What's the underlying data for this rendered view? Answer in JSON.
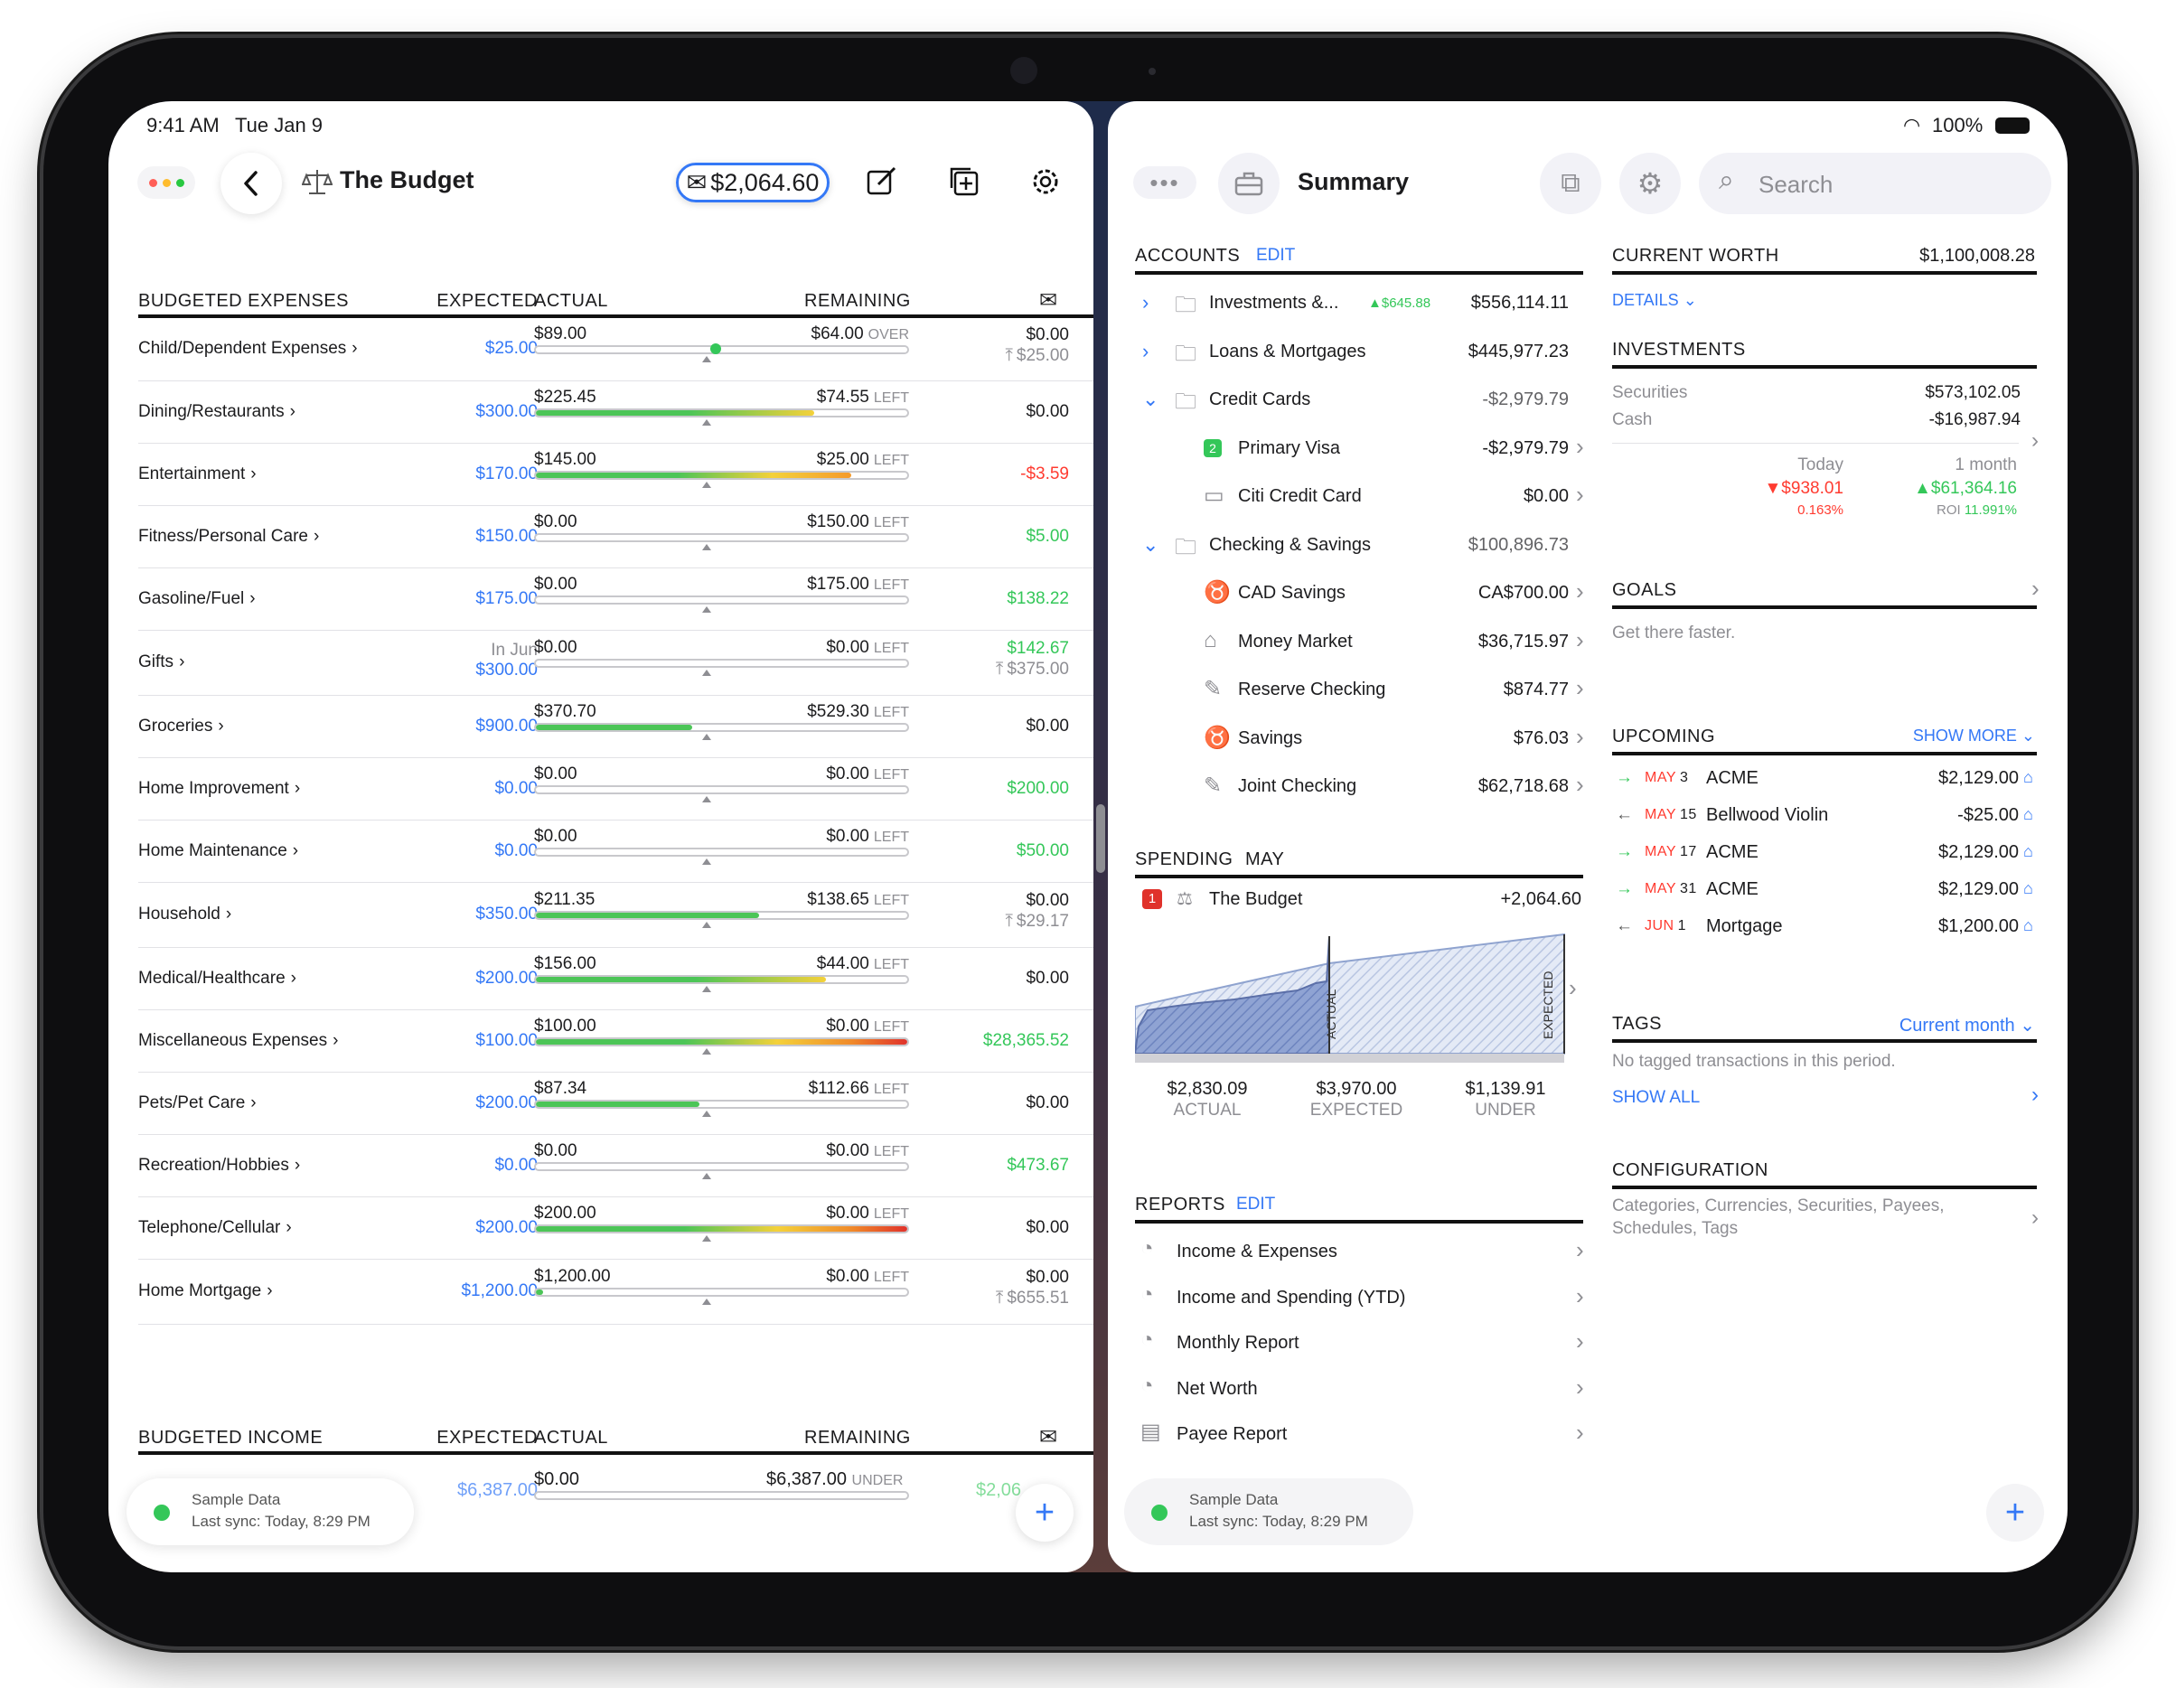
{
  "status": {
    "time": "9:41 AM",
    "date": "Tue Jan 9",
    "battery": "100%"
  },
  "left": {
    "title": "The Budget",
    "envelope_amount": "$2,064.60",
    "expenses_header": {
      "title": "BUDGETED EXPENSES",
      "expected": "EXPECTED",
      "actual": "ACTUAL",
      "remaining": "REMAINING"
    },
    "expenses": [
      {
        "name": "Child/Dependent Expenses",
        "chev": "›",
        "expected": "$25.00",
        "actual": "$89.00",
        "left": "$64.00",
        "left_label": "OVER",
        "remaining": "$0.00",
        "remaining_color": "#1c1c1e",
        "sub": "$25.00",
        "progress": 1.0,
        "bar": "over"
      },
      {
        "name": "Dining/Restaurants",
        "chev": "›",
        "expected": "$300.00",
        "actual": "$225.45",
        "left": "$74.55",
        "left_label": "LEFT",
        "remaining": "$0.00",
        "remaining_color": "#1c1c1e",
        "sub": "",
        "progress": 0.75,
        "bar": "ly"
      },
      {
        "name": "Entertainment",
        "chev": "›",
        "expected": "$170.00",
        "actual": "$145.00",
        "left": "$25.00",
        "left_label": "LEFT",
        "remaining": "-$3.59",
        "remaining_color": "#ff3b30",
        "sub": "",
        "progress": 0.85,
        "bar": "yo"
      },
      {
        "name": "Fitness/Personal Care",
        "chev": "›",
        "expected": "$150.00",
        "actual": "$0.00",
        "left": "$150.00",
        "left_label": "LEFT",
        "remaining": "$5.00",
        "remaining_color": "#34c759",
        "sub": "",
        "progress": 0,
        "bar": "g"
      },
      {
        "name": "Gasoline/Fuel",
        "chev": "›",
        "expected": "$175.00",
        "actual": "$0.00",
        "left": "$175.00",
        "left_label": "LEFT",
        "remaining": "$138.22",
        "remaining_color": "#34c759",
        "sub": "",
        "progress": 0,
        "bar": "g"
      },
      {
        "name": "Gifts",
        "chev": "›",
        "expected_pre": "In Jun",
        "expected": "$300.00",
        "actual": "$0.00",
        "left": "$0.00",
        "left_label": "LEFT",
        "remaining": "$142.67",
        "remaining_color": "#34c759",
        "sub": "$375.00",
        "progress": 0,
        "bar": "g"
      },
      {
        "name": "Groceries",
        "chev": "›",
        "expected": "$900.00",
        "actual": "$370.70",
        "left": "$529.30",
        "left_label": "LEFT",
        "remaining": "$0.00",
        "remaining_color": "#1c1c1e",
        "sub": "",
        "progress": 0.42,
        "bar": "g"
      },
      {
        "name": "Home Improvement",
        "chev": "›",
        "expected": "$0.00",
        "actual": "$0.00",
        "left": "$0.00",
        "left_label": "LEFT",
        "remaining": "$200.00",
        "remaining_color": "#34c759",
        "sub": "",
        "progress": 0,
        "bar": "g"
      },
      {
        "name": "Home Maintenance",
        "chev": "›",
        "expected": "$0.00",
        "actual": "$0.00",
        "left": "$0.00",
        "left_label": "LEFT",
        "remaining": "$50.00",
        "remaining_color": "#34c759",
        "sub": "",
        "progress": 0,
        "bar": "g"
      },
      {
        "name": "Household",
        "chev": "›",
        "expected": "$350.00",
        "actual": "$211.35",
        "left": "$138.65",
        "left_label": "LEFT",
        "remaining": "$0.00",
        "remaining_color": "#1c1c1e",
        "sub": "$29.17",
        "progress": 0.6,
        "bar": "g"
      },
      {
        "name": "Medical/Healthcare",
        "chev": "›",
        "expected": "$200.00",
        "actual": "$156.00",
        "left": "$44.00",
        "left_label": "LEFT",
        "remaining": "$0.00",
        "remaining_color": "#1c1c1e",
        "sub": "",
        "progress": 0.78,
        "bar": "ly"
      },
      {
        "name": "Miscellaneous Expenses",
        "chev": "›",
        "expected": "$100.00",
        "actual": "$100.00",
        "left": "$0.00",
        "left_label": "LEFT",
        "remaining": "$28,365.52",
        "remaining_color": "#34c759",
        "sub": "",
        "progress": 1.0,
        "bar": "gr"
      },
      {
        "name": "Pets/Pet Care",
        "chev": "›",
        "expected": "$200.00",
        "actual": "$87.34",
        "left": "$112.66",
        "left_label": "LEFT",
        "remaining": "$0.00",
        "remaining_color": "#1c1c1e",
        "sub": "",
        "progress": 0.44,
        "bar": "g"
      },
      {
        "name": "Recreation/Hobbies",
        "chev": "›",
        "expected": "$0.00",
        "actual": "$0.00",
        "left": "$0.00",
        "left_label": "LEFT",
        "remaining": "$473.67",
        "remaining_color": "#34c759",
        "sub": "",
        "progress": 0,
        "bar": "g"
      },
      {
        "name": "Telephone/Cellular",
        "chev": "›",
        "expected": "$200.00",
        "actual": "$200.00",
        "left": "$0.00",
        "left_label": "LEFT",
        "remaining": "$0.00",
        "remaining_color": "#1c1c1e",
        "sub": "",
        "progress": 1.0,
        "bar": "gr"
      },
      {
        "name": "Home Mortgage",
        "chev": "›",
        "expected": "$1,200.00",
        "actual": "$1,200.00",
        "left": "$0.00",
        "left_label": "LEFT",
        "remaining": "$0.00",
        "remaining_color": "#1c1c1e",
        "sub": "$655.51",
        "progress": 0.02,
        "bar": "g"
      }
    ],
    "income_header": {
      "title": "BUDGETED INCOME",
      "expected": "EXPECTED",
      "actual": "ACTUAL",
      "remaining": "REMAINING"
    },
    "income": {
      "expected": "$6,387.00",
      "actual": "$0.00",
      "left": "$6,387.00",
      "left_label": "UNDER",
      "remaining": "$2,06"
    },
    "sync": {
      "title": "Sample Data",
      "sub": "Last sync: Today, 8:29 PM"
    }
  },
  "right": {
    "title": "Summary",
    "search_placeholder": "Search",
    "accounts": {
      "title": "ACCOUNTS",
      "edit": "EDIT",
      "rows": [
        {
          "name": "Investments &...",
          "badge": "▲$645.88",
          "value": "$556,114.11",
          "indent": 0,
          "disc": "›",
          "icon": "folder-icon"
        },
        {
          "name": "Loans & Mortgages",
          "value": "$445,977.23",
          "indent": 0,
          "disc": "›",
          "icon": "folder-icon"
        },
        {
          "name": "Credit Cards",
          "value": "-$2,979.79",
          "indent": 0,
          "disc": "⌄",
          "icon": "folder-icon",
          "muted": true
        },
        {
          "name": "Primary Visa",
          "value": "-$2,979.79",
          "indent": 1,
          "icon": "badge-2-icon",
          "chev": "›"
        },
        {
          "name": "Citi Credit Card",
          "value": "$0.00",
          "indent": 1,
          "icon": "card-icon",
          "chev": "›"
        },
        {
          "name": "Checking & Savings",
          "value": "$100,896.73",
          "indent": 0,
          "disc": "⌄",
          "icon": "folder-icon",
          "muted": true
        },
        {
          "name": "CAD Savings",
          "value": "CA$700.00",
          "indent": 1,
          "icon": "pig-icon",
          "chev": "›"
        },
        {
          "name": "Money Market",
          "value": "$36,715.97",
          "indent": 1,
          "icon": "bank-icon",
          "chev": "›"
        },
        {
          "name": "Reserve Checking",
          "value": "$874.77",
          "indent": 1,
          "icon": "check-icon",
          "chev": "›"
        },
        {
          "name": "Savings",
          "value": "$76.03",
          "indent": 1,
          "icon": "pig-icon",
          "chev": "›"
        },
        {
          "name": "Joint Checking",
          "value": "$62,718.68",
          "indent": 1,
          "icon": "check-icon",
          "chev": "›"
        }
      ]
    },
    "spending": {
      "title": "SPENDING",
      "period": "MAY",
      "badge": "1",
      "budget": "The Budget",
      "amount": "+2,064.60",
      "stats": [
        {
          "value": "$2,830.09",
          "label": "ACTUAL"
        },
        {
          "value": "$3,970.00",
          "label": "EXPECTED"
        },
        {
          "value": "$1,139.91",
          "label": "UNDER"
        }
      ],
      "chart_labels": {
        "actual": "ACTUAL",
        "expected": "EXPECTED"
      }
    },
    "reports": {
      "title": "REPORTS",
      "edit": "EDIT",
      "items": [
        "Income & Expenses",
        "Income and Spending (YTD)",
        "Monthly Report",
        "Net Worth",
        "Payee Report"
      ]
    },
    "worth": {
      "title": "CURRENT WORTH",
      "value": "$1,100,008.28",
      "details": "DETAILS"
    },
    "investments": {
      "title": "INVESTMENTS",
      "securities_label": "Securities",
      "securities": "$573,102.05",
      "cash_label": "Cash",
      "cash": "-$16,987.94",
      "today_label": "Today",
      "today_value": "▼$938.01",
      "today_pct": "0.163%",
      "month_label": "1 month",
      "month_value": "▲$61,364.16",
      "month_roi": "ROI",
      "month_pct": "11.991%"
    },
    "goals": {
      "title": "GOALS",
      "sub": "Get there faster."
    },
    "upcoming": {
      "title": "UPCOMING",
      "more": "SHOW MORE",
      "items": [
        {
          "dir": "→",
          "date": "MAY",
          "day": "3",
          "payee": "ACME",
          "amount": "$2,129.00"
        },
        {
          "dir": "←",
          "date": "MAY",
          "day": "15",
          "payee": "Bellwood Violin",
          "amount": "-$25.00"
        },
        {
          "dir": "→",
          "date": "MAY",
          "day": "17",
          "payee": "ACME",
          "amount": "$2,129.00"
        },
        {
          "dir": "→",
          "date": "MAY",
          "day": "31",
          "payee": "ACME",
          "amount": "$2,129.00"
        },
        {
          "dir": "←",
          "date": "JUN",
          "day": "1",
          "payee": "Mortgage",
          "amount": "$1,200.00"
        }
      ]
    },
    "tags": {
      "title": "TAGS",
      "period": "Current month",
      "sub": "No tagged transactions in this period.",
      "show_all": "SHOW ALL"
    },
    "config": {
      "title": "CONFIGURATION",
      "sub": "Categories, Currencies, Securities, Payees, Schedules, Tags"
    },
    "sync": {
      "title": "Sample Data",
      "sub": "Last sync: Today, 8:29 PM"
    }
  },
  "colors": {
    "accent": "#3478f6",
    "positive": "#34c759",
    "negative": "#ff3b30",
    "chart_actual": "#8ea2d4",
    "chart_expected": "#d7e0f2"
  }
}
